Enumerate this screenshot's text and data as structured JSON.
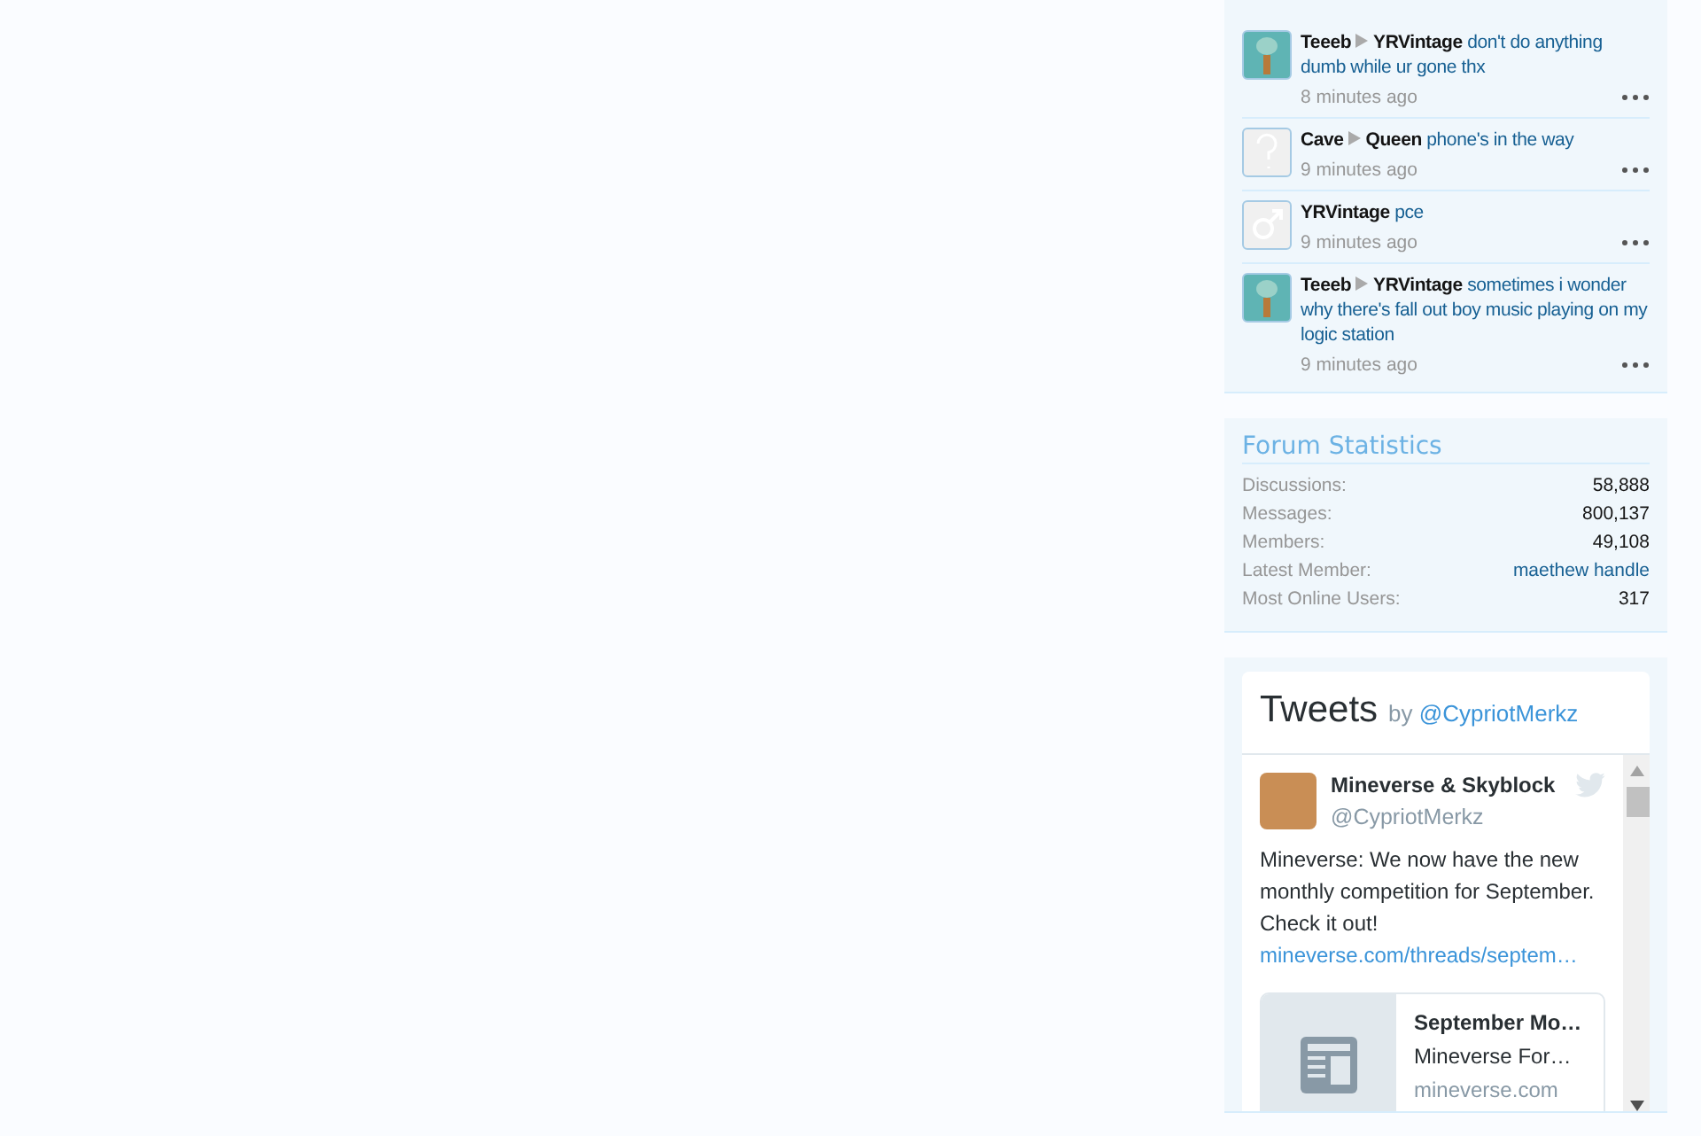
{
  "shoutbox": {
    "items": [
      {
        "kind": "character",
        "sender": "Teeeb",
        "recipient": "YRVintage",
        "message": "don't do anything dumb while ur gone thx",
        "time": "8 minutes ago"
      },
      {
        "kind": "unknown",
        "sender": "Cave",
        "recipient": "Queen",
        "message": "phone's in the way",
        "time": "9 minutes ago"
      },
      {
        "kind": "male",
        "sender": "YRVintage",
        "message": "pce",
        "time": "9 minutes ago"
      },
      {
        "kind": "character",
        "sender": "Teeeb",
        "recipient": "YRVintage",
        "message": "sometimes i wonder why there's fall out boy music playing on my logic station",
        "time": "9 minutes ago"
      }
    ]
  },
  "forum_statistics": {
    "title": "Forum Statistics",
    "rows": [
      {
        "label": "Discussions:",
        "value": "58,888",
        "kind": "text"
      },
      {
        "label": "Messages:",
        "value": "800,137",
        "kind": "text"
      },
      {
        "label": "Members:",
        "value": "49,108",
        "kind": "text"
      },
      {
        "label": "Latest Member:",
        "value": "maethew handle",
        "kind": "link"
      },
      {
        "label": "Most Online Users:",
        "value": "317",
        "kind": "text"
      }
    ]
  },
  "tweets": {
    "title": "Tweets",
    "by": "by",
    "handle_link": "@CypriotMerkz",
    "tweet": {
      "name": "Mineverse & Skyblock",
      "handle": "@CypriotMerkz",
      "text": "Mineverse: We now have the new monthly competition for September. Check it out!",
      "link": "mineverse.com/threads/septem…",
      "card": {
        "title": "September Mo…",
        "site": "Mineverse For…",
        "domain": "mineverse.com"
      }
    }
  }
}
